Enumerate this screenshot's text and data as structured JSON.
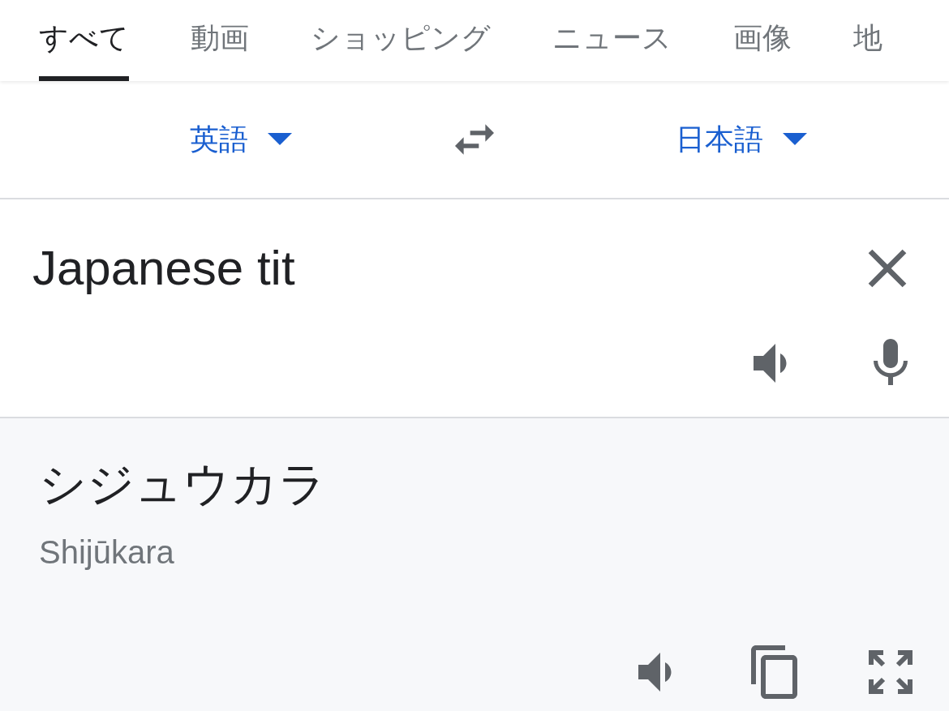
{
  "tabs": [
    {
      "label": "すべて",
      "selected": true
    },
    {
      "label": "動画",
      "selected": false
    },
    {
      "label": "ショッピング",
      "selected": false
    },
    {
      "label": "ニュース",
      "selected": false
    },
    {
      "label": "画像",
      "selected": false
    },
    {
      "label": "地",
      "selected": false
    }
  ],
  "languages": {
    "source": "英語",
    "target": "日本語"
  },
  "input": {
    "value": "Japanese tit"
  },
  "output": {
    "text": "シジュウカラ",
    "romanization": "Shijūkara"
  }
}
